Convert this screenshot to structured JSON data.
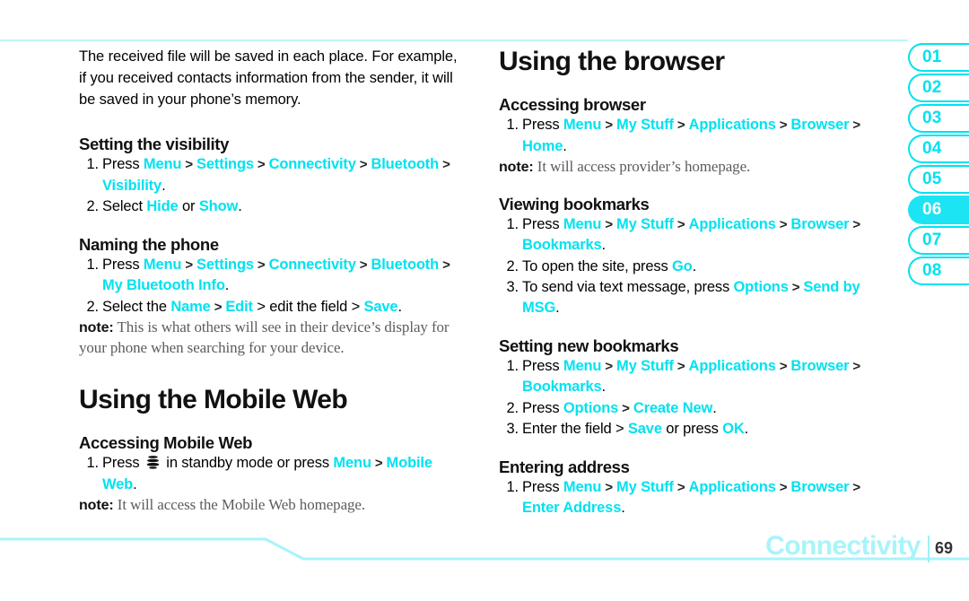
{
  "page": {
    "footer_section": "Connectivity",
    "footer_page_number": "69",
    "accent_cyan": "#00e2f0",
    "accent_pale_cyan": "#a8f4fa"
  },
  "side_tabs": {
    "items": [
      {
        "label": "01",
        "active": false
      },
      {
        "label": "02",
        "active": false
      },
      {
        "label": "03",
        "active": false
      },
      {
        "label": "04",
        "active": false
      },
      {
        "label": "05",
        "active": false
      },
      {
        "label": "06",
        "active": true
      },
      {
        "label": "07",
        "active": false
      },
      {
        "label": "08",
        "active": false
      }
    ]
  },
  "left_column": {
    "intro_paragraph": "The received file will be saved in each place. For example, if you received contacts information from the sender, it will be saved in your phone’s memory.",
    "sections": [
      {
        "heading": "Setting the visibility",
        "steps": [
          {
            "num": "1.",
            "parts": [
              {
                "t": "Press ",
                "s": "plain"
              },
              {
                "t": "Menu",
                "s": "cyan"
              },
              {
                "t": " > ",
                "s": "sep"
              },
              {
                "t": "Settings",
                "s": "cyan"
              },
              {
                "t": " > ",
                "s": "sep"
              },
              {
                "t": "Connectivity",
                "s": "cyan"
              },
              {
                "t": " > ",
                "s": "sep"
              },
              {
                "t": "Bluetooth",
                "s": "cyan"
              },
              {
                "t": " > ",
                "s": "sep"
              },
              {
                "t": "Visibility",
                "s": "cyan"
              },
              {
                "t": ".",
                "s": "plain"
              }
            ]
          },
          {
            "num": "2.",
            "parts": [
              {
                "t": "Select ",
                "s": "plain"
              },
              {
                "t": "Hide",
                "s": "cyan"
              },
              {
                "t": " or ",
                "s": "plain"
              },
              {
                "t": "Show",
                "s": "cyan"
              },
              {
                "t": ".",
                "s": "plain"
              }
            ]
          }
        ]
      },
      {
        "heading": "Naming the phone",
        "steps": [
          {
            "num": "1.",
            "parts": [
              {
                "t": "Press ",
                "s": "plain"
              },
              {
                "t": "Menu",
                "s": "cyan"
              },
              {
                "t": " > ",
                "s": "sep"
              },
              {
                "t": "Settings",
                "s": "cyan"
              },
              {
                "t": " > ",
                "s": "sep"
              },
              {
                "t": "Connectivity",
                "s": "cyan"
              },
              {
                "t": " > ",
                "s": "sep"
              },
              {
                "t": "Bluetooth",
                "s": "cyan"
              },
              {
                "t": " > ",
                "s": "sep"
              },
              {
                "t": "My Bluetooth Info",
                "s": "cyan"
              },
              {
                "t": ".",
                "s": "plain"
              }
            ]
          },
          {
            "num": "2.",
            "parts": [
              {
                "t": "Select the ",
                "s": "plain"
              },
              {
                "t": "Name",
                "s": "cyan"
              },
              {
                "t": " > ",
                "s": "sep"
              },
              {
                "t": "Edit",
                "s": "cyan"
              },
              {
                "t": " > edit the field > ",
                "s": "plain"
              },
              {
                "t": "Save",
                "s": "cyan"
              },
              {
                "t": ".",
                "s": "plain"
              }
            ]
          }
        ],
        "note_label": "note:",
        "note_text": " This is what others will see in their device’s display for your phone when searching for your device."
      }
    ],
    "main_heading": "Using the Mobile Web",
    "mobile_web": {
      "heading": "Accessing Mobile Web",
      "steps": [
        {
          "num": "1.",
          "parts": [
            {
              "t": "Press ",
              "s": "plain"
            },
            {
              "t": "att-globe-icon",
              "s": "icon"
            },
            {
              "t": " in standby mode or press ",
              "s": "plain"
            },
            {
              "t": "Menu",
              "s": "cyan"
            },
            {
              "t": " > ",
              "s": "sep"
            },
            {
              "t": "Mobile Web",
              "s": "cyan"
            },
            {
              "t": ".",
              "s": "plain"
            }
          ]
        }
      ],
      "note_label": "note:",
      "note_text": " It will access the Mobile Web homepage."
    }
  },
  "right_column": {
    "main_heading": "Using the browser",
    "sections": [
      {
        "heading": "Accessing browser",
        "steps": [
          {
            "num": "1.",
            "parts": [
              {
                "t": "Press ",
                "s": "plain"
              },
              {
                "t": "Menu",
                "s": "cyan"
              },
              {
                "t": " > ",
                "s": "sep"
              },
              {
                "t": "My Stuff",
                "s": "cyan"
              },
              {
                "t": " > ",
                "s": "sep"
              },
              {
                "t": "Applications",
                "s": "cyan"
              },
              {
                "t": " > ",
                "s": "sep"
              },
              {
                "t": "Browser",
                "s": "cyan"
              },
              {
                "t": " > ",
                "s": "sep"
              },
              {
                "t": "Home",
                "s": "cyan"
              },
              {
                "t": ".",
                "s": "plain"
              }
            ]
          }
        ],
        "note_label": "note:",
        "note_text": " It will access provider’s homepage."
      },
      {
        "heading": "Viewing bookmarks",
        "steps": [
          {
            "num": "1.",
            "parts": [
              {
                "t": "Press ",
                "s": "plain"
              },
              {
                "t": "Menu",
                "s": "cyan"
              },
              {
                "t": " > ",
                "s": "sep"
              },
              {
                "t": "My Stuff",
                "s": "cyan"
              },
              {
                "t": " > ",
                "s": "sep"
              },
              {
                "t": "Applications",
                "s": "cyan"
              },
              {
                "t": " > ",
                "s": "sep"
              },
              {
                "t": "Browser",
                "s": "cyan"
              },
              {
                "t": " > ",
                "s": "sep"
              },
              {
                "t": "Bookmarks",
                "s": "cyan"
              },
              {
                "t": ".",
                "s": "plain"
              }
            ]
          },
          {
            "num": "2.",
            "parts": [
              {
                "t": "To open the site, press ",
                "s": "plain"
              },
              {
                "t": "Go",
                "s": "cyan"
              },
              {
                "t": ".",
                "s": "plain"
              }
            ]
          },
          {
            "num": "3.",
            "parts": [
              {
                "t": "To send via text message, press ",
                "s": "plain"
              },
              {
                "t": "Options",
                "s": "cyan"
              },
              {
                "t": " > ",
                "s": "sep"
              },
              {
                "t": "Send by MSG",
                "s": "cyan"
              },
              {
                "t": ".",
                "s": "plain"
              }
            ]
          }
        ],
        "note_label": "",
        "note_text": ""
      },
      {
        "heading": "Setting new bookmarks",
        "steps": [
          {
            "num": "1.",
            "parts": [
              {
                "t": "Press ",
                "s": "plain"
              },
              {
                "t": "Menu",
                "s": "cyan"
              },
              {
                "t": " > ",
                "s": "sep"
              },
              {
                "t": "My Stuff",
                "s": "cyan"
              },
              {
                "t": " > ",
                "s": "sep"
              },
              {
                "t": "Applications",
                "s": "cyan"
              },
              {
                "t": " > ",
                "s": "sep"
              },
              {
                "t": "Browser",
                "s": "cyan"
              },
              {
                "t": " > ",
                "s": "sep"
              },
              {
                "t": "Bookmarks",
                "s": "cyan"
              },
              {
                "t": ".",
                "s": "plain"
              }
            ]
          },
          {
            "num": "2.",
            "parts": [
              {
                "t": "Press ",
                "s": "plain"
              },
              {
                "t": "Options",
                "s": "cyan"
              },
              {
                "t": " > ",
                "s": "sep"
              },
              {
                "t": "Create New",
                "s": "cyan"
              },
              {
                "t": ".",
                "s": "plain"
              }
            ]
          },
          {
            "num": "3.",
            "parts": [
              {
                "t": "Enter the field > ",
                "s": "plain"
              },
              {
                "t": "Save",
                "s": "cyan"
              },
              {
                "t": " or press ",
                "s": "plain"
              },
              {
                "t": "OK",
                "s": "cyan"
              },
              {
                "t": ".",
                "s": "plain"
              }
            ]
          }
        ],
        "note_label": "",
        "note_text": ""
      },
      {
        "heading": "Entering address",
        "steps": [
          {
            "num": "1.",
            "parts": [
              {
                "t": "Press ",
                "s": "plain"
              },
              {
                "t": "Menu",
                "s": "cyan"
              },
              {
                "t": " > ",
                "s": "sep"
              },
              {
                "t": "My Stuff",
                "s": "cyan"
              },
              {
                "t": " > ",
                "s": "sep"
              },
              {
                "t": "Applications",
                "s": "cyan"
              },
              {
                "t": " > ",
                "s": "sep"
              },
              {
                "t": "Browser",
                "s": "cyan"
              },
              {
                "t": " > ",
                "s": "sep"
              },
              {
                "t": "Enter Address",
                "s": "cyan"
              },
              {
                "t": ".",
                "s": "plain"
              }
            ]
          }
        ],
        "note_label": "",
        "note_text": ""
      }
    ]
  }
}
